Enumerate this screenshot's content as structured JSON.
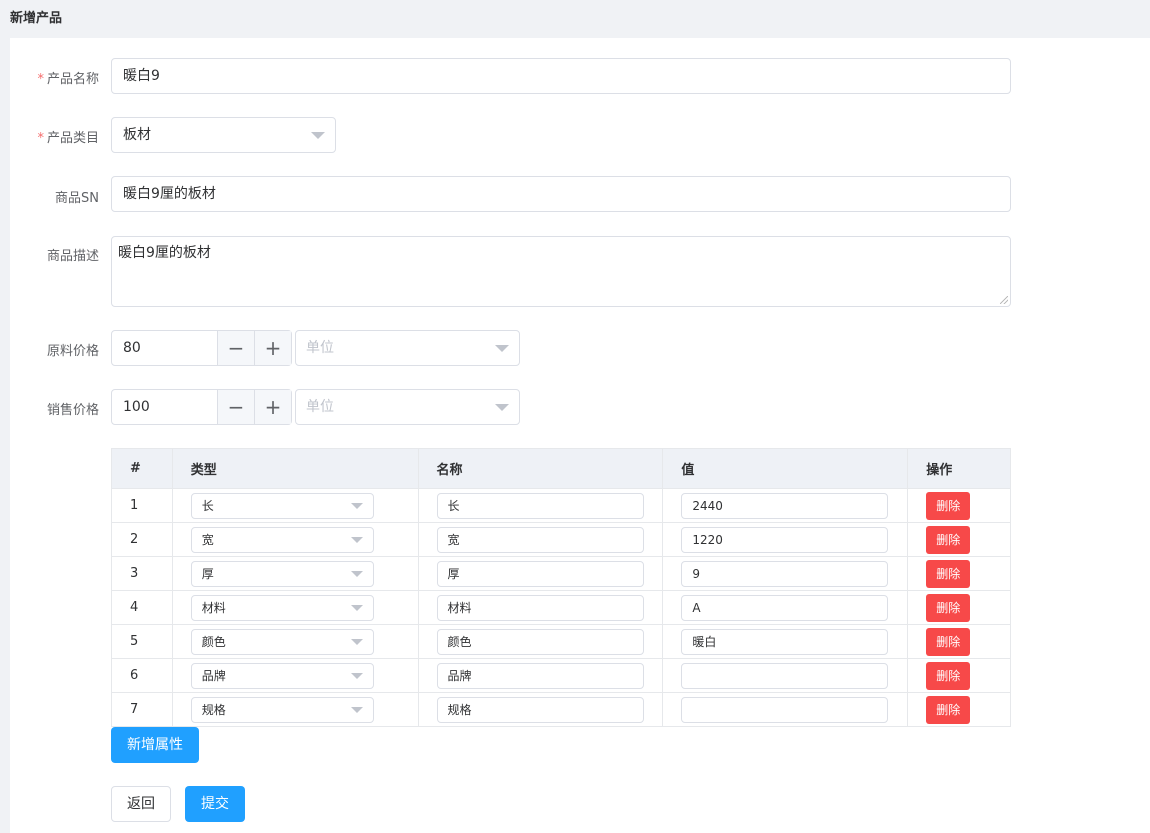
{
  "header": {
    "title": "新增产品"
  },
  "form": {
    "name": {
      "label": "产品名称",
      "required_mark": "*",
      "value": "暖白9"
    },
    "category": {
      "label": "产品类目",
      "required_mark": "*",
      "value": "板材"
    },
    "sn": {
      "label": "商品SN",
      "value": "暖白9厘的板材"
    },
    "desc": {
      "label": "商品描述",
      "value": "暖白9厘的板材"
    },
    "raw_price": {
      "label": "原料价格",
      "value": "80",
      "unit_placeholder": "单位"
    },
    "sale_price": {
      "label": "销售价格",
      "value": "100",
      "unit_placeholder": "单位"
    }
  },
  "attr_table": {
    "headers": [
      "#",
      "类型",
      "名称",
      "值",
      "操作"
    ],
    "delete_label": "删除",
    "rows": [
      {
        "index": "1",
        "type": "长",
        "name": "长",
        "value": "2440"
      },
      {
        "index": "2",
        "type": "宽",
        "name": "宽",
        "value": "1220"
      },
      {
        "index": "3",
        "type": "厚",
        "name": "厚",
        "value": "9"
      },
      {
        "index": "4",
        "type": "材料",
        "name": "材料",
        "value": "A"
      },
      {
        "index": "5",
        "type": "颜色",
        "name": "颜色",
        "value": "暖白"
      },
      {
        "index": "6",
        "type": "品牌",
        "name": "品牌",
        "value": ""
      },
      {
        "index": "7",
        "type": "规格",
        "name": "规格",
        "value": ""
      }
    ]
  },
  "buttons": {
    "add_attr": "新增属性",
    "back": "返回",
    "submit": "提交"
  },
  "icons": {
    "caret": "caret-down-icon",
    "minus": "minus-icon",
    "plus": "plus-icon"
  },
  "colors": {
    "primary": "#20a0ff",
    "danger": "#f74949",
    "required": "#f56c6c"
  }
}
